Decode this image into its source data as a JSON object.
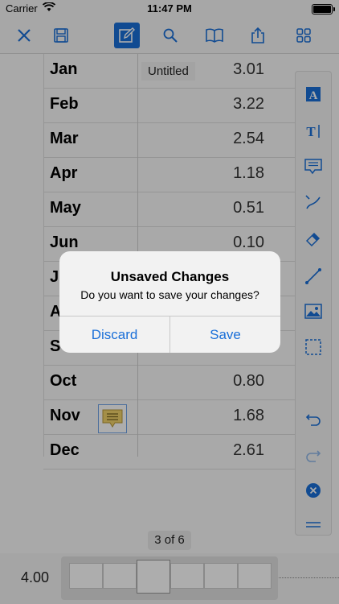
{
  "status_bar": {
    "carrier": "Carrier",
    "time": "11:47 PM"
  },
  "toolbar": {
    "items": [
      "close-icon",
      "save-icon",
      "edit-icon",
      "search-icon",
      "book-icon",
      "share-icon",
      "grid-icon"
    ],
    "active": "edit-icon"
  },
  "document": {
    "sheet_title": "Untitled",
    "rows": [
      {
        "month": "Jan",
        "value": "3.01"
      },
      {
        "month": "Feb",
        "value": "3.22"
      },
      {
        "month": "Mar",
        "value": "2.54"
      },
      {
        "month": "Apr",
        "value": "1.18"
      },
      {
        "month": "May",
        "value": "0.51"
      },
      {
        "month": "Jun",
        "value": "0.10"
      },
      {
        "month": "J",
        "value": ""
      },
      {
        "month": "A",
        "value": ""
      },
      {
        "month": "S",
        "value": ""
      },
      {
        "month": "Oct",
        "value": "0.80"
      },
      {
        "month": "Nov",
        "value": "1.68"
      },
      {
        "month": "Dec",
        "value": "2.61"
      }
    ]
  },
  "tools": [
    "text-box-icon",
    "text-cursor-icon",
    "comment-icon",
    "pen-icon",
    "eraser-icon",
    "line-icon",
    "image-icon",
    "selection-icon",
    "undo-icon",
    "redo-icon",
    "clear-icon",
    "menu-icon"
  ],
  "footer": {
    "page_indicator": "3 of 6",
    "zoom_value": "4.00"
  },
  "dialog": {
    "title": "Unsaved Changes",
    "message": "Do you want to save your changes?",
    "discard_label": "Discard",
    "save_label": "Save"
  },
  "colors": {
    "accent": "#1a6fd8"
  }
}
